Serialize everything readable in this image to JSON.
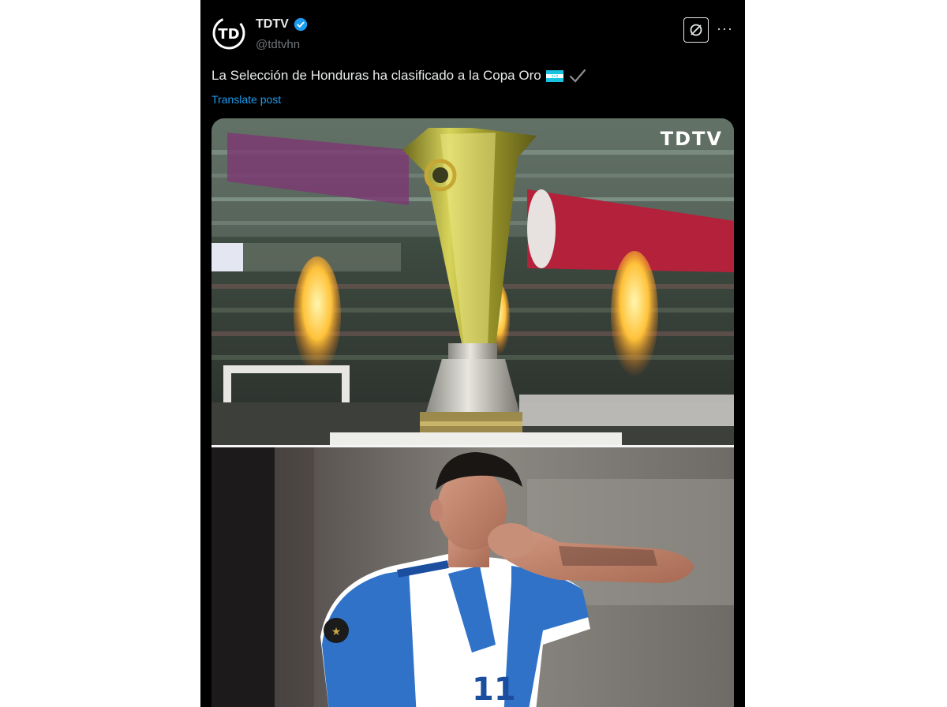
{
  "post": {
    "display_name": "TDTV",
    "handle": "@tdtvhn",
    "text": "La Selección de Honduras ha clasificado a la Copa Oro",
    "translate_label": "Translate post",
    "more_label": "···",
    "media": {
      "watermark": "TDTV"
    }
  },
  "colors": {
    "background": "#000000",
    "text": "#e7e9ea",
    "secondary": "#71767b",
    "link": "#1d9bf0",
    "verified": "#1d9bf0"
  },
  "icons": {
    "avatar": "tdtv-logo-icon",
    "verified": "verified-badge-icon",
    "grok": "grok-icon",
    "more": "more-icon",
    "flag": "honduras-flag-icon",
    "check": "check-mark-icon"
  }
}
